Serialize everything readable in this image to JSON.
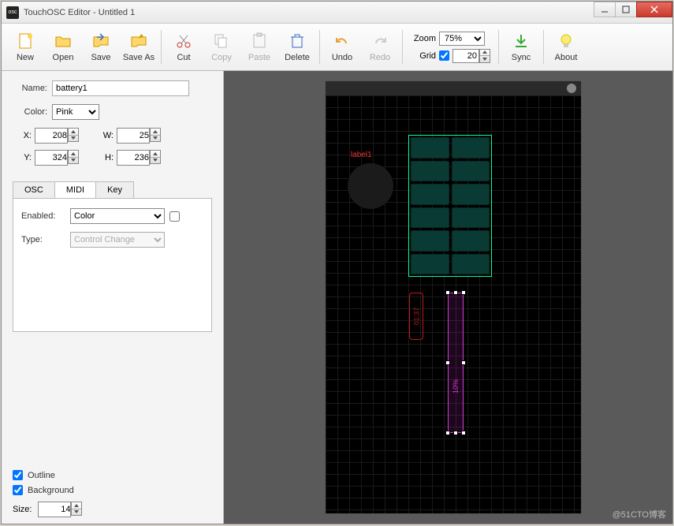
{
  "window": {
    "title": "TouchOSC Editor - Untitled 1"
  },
  "toolbar": {
    "new": "New",
    "open": "Open",
    "save": "Save",
    "saveas": "Save As",
    "cut": "Cut",
    "copy": "Copy",
    "paste": "Paste",
    "delete": "Delete",
    "undo": "Undo",
    "redo": "Redo",
    "sync": "Sync",
    "about": "About",
    "zoom_label": "Zoom",
    "zoom_value": "75%",
    "grid_label": "Grid",
    "grid_checked": true,
    "grid_value": "20"
  },
  "props": {
    "name_label": "Name:",
    "name_value": "battery1",
    "color_label": "Color:",
    "color_value": "Pink",
    "x_label": "X:",
    "x_value": "208",
    "y_label": "Y:",
    "y_value": "324",
    "w_label": "W:",
    "w_value": "25",
    "h_label": "H:",
    "h_value": "236"
  },
  "tabs": {
    "osc": "OSC",
    "midi": "MIDI",
    "key": "Key",
    "enabled_label": "Enabled:",
    "enabled_value": "Color",
    "type_label": "Type:",
    "type_value": "Control Change"
  },
  "checks": {
    "outline": "Outline",
    "background": "Background",
    "size_label": "Size:",
    "size_value": "14"
  },
  "canvas": {
    "label1": "label1",
    "time_text": "01:37",
    "battery_text": "10%"
  },
  "watermark": "@51CTO博客"
}
